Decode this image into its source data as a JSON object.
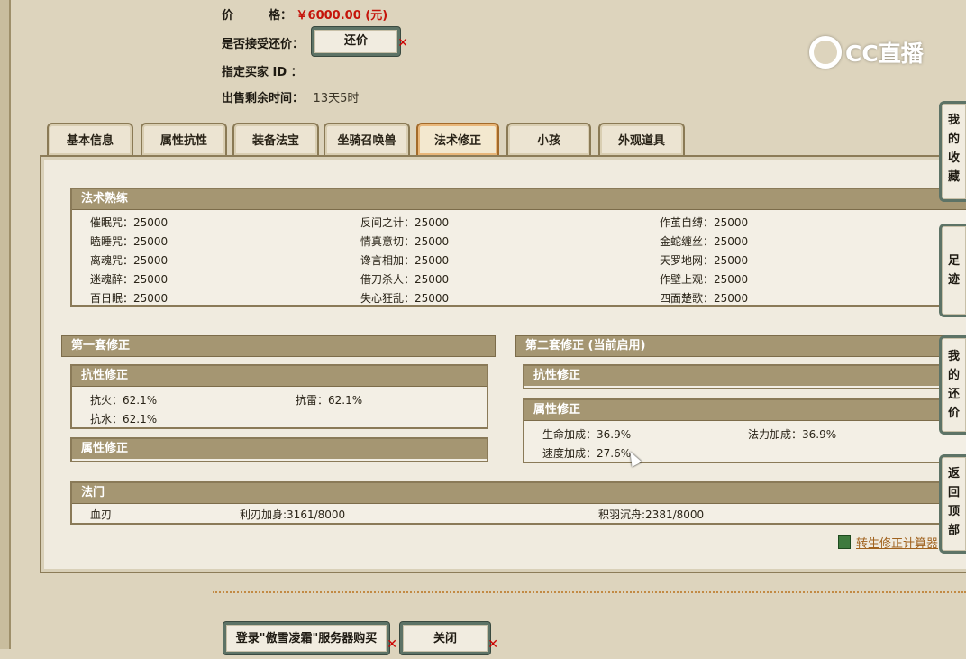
{
  "top_info": {
    "price_label": "价　　　格：",
    "price_value": "￥6000.00 (元)",
    "counter_label": "是否接受还价：",
    "counter_button": "还价",
    "buyer_label": "指定买家 ID ：",
    "remaining_label": "出售剩余时间：",
    "remaining_value": "13天5时"
  },
  "tabs": [
    "基本信息",
    "属性抗性",
    "装备法宝",
    "坐骑召唤兽",
    "法术修正",
    "小孩",
    "外观道具"
  ],
  "active_tab": "法术修正",
  "spell_proficiency": {
    "header": "法术熟练",
    "rows": [
      [
        "催眠咒：25000",
        "反间之计：25000",
        "作茧自缚：25000"
      ],
      [
        "瞌睡咒：25000",
        "情真意切：25000",
        "金蛇缠丝：25000"
      ],
      [
        "离魂咒：25000",
        "谗言相加：25000",
        "天罗地网：25000"
      ],
      [
        "迷魂醉：25000",
        "借刀杀人：25000",
        "作壁上观：25000"
      ],
      [
        "百日眠：25000",
        "失心狂乱：25000",
        "四面楚歌：25000"
      ]
    ]
  },
  "set1": {
    "header": "第一套修正",
    "resist_header": "抗性修正",
    "resist_rows": [
      [
        "抗火：62.1%",
        "抗雷：62.1%"
      ],
      [
        "抗水：62.1%",
        ""
      ]
    ],
    "attr_header": "属性修正"
  },
  "set2": {
    "header": "第二套修正 (当前启用)",
    "resist_header": "抗性修正",
    "attr_header": "属性修正",
    "attr_rows": [
      [
        "生命加成：36.9%",
        "法力加成：36.9%"
      ],
      [
        "速度加成：27.6%",
        ""
      ]
    ]
  },
  "famen": {
    "header": "法门",
    "items": [
      "血刃",
      "利刃加身:3161/8000",
      "积羽沉舟:2381/8000"
    ]
  },
  "calc_link": "转生修正计算器",
  "bottom_buttons": {
    "login_buy": "登录\"傲雪凌霜\"服务器购买",
    "close": "关闭"
  },
  "sidebar": [
    "我的收藏",
    "足迹",
    "我的还价",
    "返回顶部"
  ],
  "logo": "CC直播",
  "icons": [
    "close-x-icon",
    "calculator-icon",
    "cc-logo-icon",
    "mouse-cursor-icon"
  ],
  "colors": {
    "price": "#c5140a",
    "header_bar": "#a59672",
    "button_border": "#5d7366",
    "link": "#a0621e"
  }
}
